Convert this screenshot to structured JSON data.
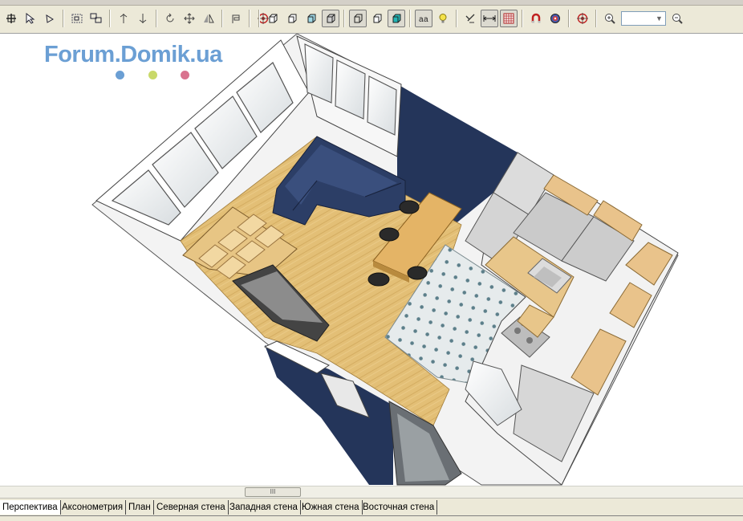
{
  "toolbar": {
    "zoom_value": "",
    "buttons_left": [
      "select-add-icon",
      "pointer-icon",
      "edit-node-icon",
      "group-icon",
      "ungroup-icon",
      "align-vertical-icon",
      "align-horizontal-icon",
      "rotate-icon",
      "move-icon",
      "mirror-icon",
      "attach-icon",
      "target-icon"
    ],
    "buttons_view": [
      "view-front-icon",
      "view-box-icon",
      "view-box-shaded-icon",
      "view-box-solid-icon",
      "view-wire-icon",
      "view-wire-2-icon",
      "view-textured-icon",
      "text-labels-icon",
      "light-bulb-icon",
      "measure-icon",
      "dimension-icon",
      "grid-icon",
      "magnet-icon",
      "snap-target-icon",
      "center-target-icon",
      "zoom-in-icon",
      "zoom-out-icon"
    ]
  },
  "watermark": {
    "text": "Forum.Domik.ua",
    "dot_colors": [
      "#6b9fd4",
      "#c9d96a",
      "#d9738e"
    ]
  },
  "scrollbar": {
    "thumb_glyph": "III"
  },
  "tabs": [
    {
      "label": "Перспектива",
      "active": true
    },
    {
      "label": "Аксонометрия",
      "active": false
    },
    {
      "label": "План",
      "active": false
    },
    {
      "label": "Северная стена",
      "active": false
    },
    {
      "label": "Западная стена",
      "active": false
    },
    {
      "label": "Южная стена",
      "active": false
    },
    {
      "label": "Восточная стена",
      "active": false
    }
  ]
}
